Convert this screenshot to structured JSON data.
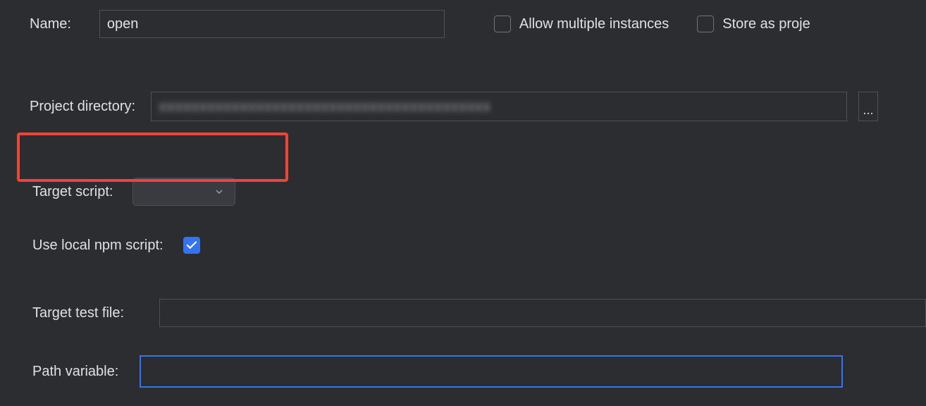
{
  "name": {
    "label": "Name:",
    "value": "open"
  },
  "allowMultiple": {
    "label": "Allow multiple instances",
    "checked": false
  },
  "storeAsProj": {
    "label": "Store as proje",
    "checked": false
  },
  "projectDirectory": {
    "label": "Project directory:",
    "value": ""
  },
  "targetScript": {
    "label": "Target script:",
    "value": ""
  },
  "useLocalNpm": {
    "label": "Use local npm script:",
    "checked": true
  },
  "targetTestFile": {
    "label": "Target test file:",
    "value": ""
  },
  "pathVariable": {
    "label": "Path variable:",
    "value": ""
  },
  "browseLabel": "..."
}
